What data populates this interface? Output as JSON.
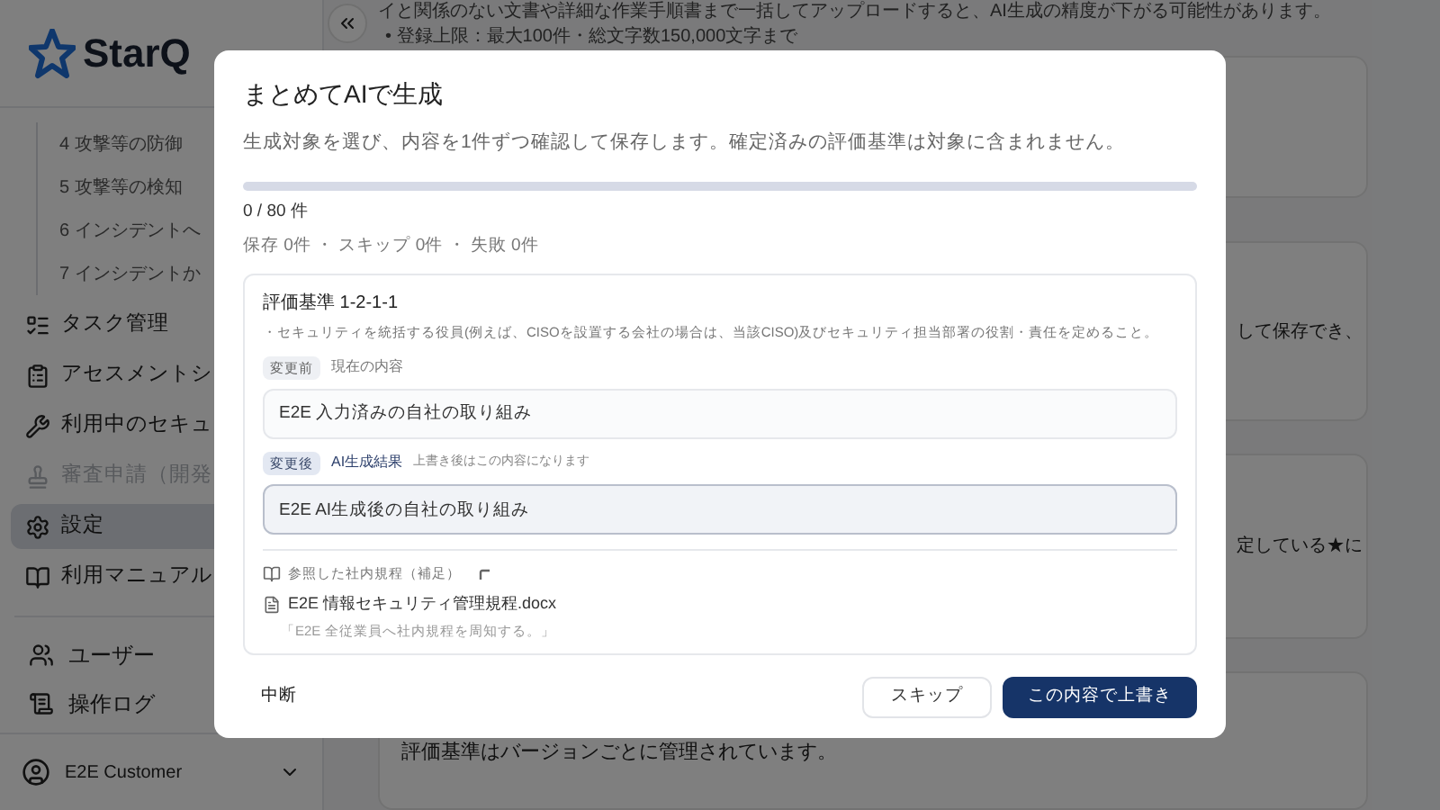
{
  "sidebar": {
    "logo": "StarQ",
    "sub_items": [
      "4 攻撃等の防御",
      "5 攻撃等の検知",
      "6 インシデントへ",
      "7 インシデントか"
    ],
    "items": [
      {
        "label": "タスク管理",
        "selected": false,
        "disabled": false
      },
      {
        "label": "アセスメントシ",
        "selected": false,
        "disabled": false
      },
      {
        "label": "利用中のセキュ",
        "selected": false,
        "disabled": false
      },
      {
        "label": "審査申請（開発",
        "selected": false,
        "disabled": true
      },
      {
        "label": "設定",
        "selected": true,
        "disabled": false
      },
      {
        "label": "利用マニュアル",
        "selected": false,
        "disabled": false
      }
    ],
    "admin_items": [
      "ユーザー",
      "操作ログ"
    ],
    "user": "E2E Customer"
  },
  "main": {
    "bullet": "•",
    "intro": [
      "イと関係のない文書や詳細な作業手順書まで一括してアップロードすると、AI生成の精度が下がる可能性があります。",
      "登録上限：最大100件・総文字数150,000文字まで"
    ],
    "card_texts": [
      "して保存でき、",
      "定している★に"
    ],
    "version_description": "評価基準はバージョンごとに管理されています。"
  },
  "dialog": {
    "title": "まとめてAIで生成",
    "description": "生成対象を選び、内容を1件ずつ確認して保存します。確定済みの評価基準は対象に含まれません。",
    "progress": {
      "level": 0
    },
    "count": "0 / 80 件",
    "summary": "保存 0件 ・ スキップ 0件 ・ 失敗 0件",
    "item": {
      "title": "評価基準 1-2-1-1",
      "description": "・セキュリティを統括する役員(例えば、CISOを設置する会社の場合は、当該CISO)及びセキュリティ担当部署の役割・責任を定めること。",
      "before": {
        "badge": "変更前",
        "label": "現在の内容",
        "value": "E2E 入力済みの自社の取り組み"
      },
      "after": {
        "badge": "変更後",
        "label": "AI生成結果",
        "hint": "上書き後はこの内容になります",
        "value": "E2E AI生成後の自社の取り組み"
      },
      "references": {
        "label": "参照した社内規程（補足）",
        "files": [
          {
            "name": "E2E 情報セキュリティ管理規程.docx",
            "quote": "「E2E 全従業員へ社内規程を周知する。」"
          }
        ]
      }
    },
    "buttons": {
      "abort": "中断",
      "skip": "スキップ",
      "overwrite": "この内容で上書き"
    }
  }
}
